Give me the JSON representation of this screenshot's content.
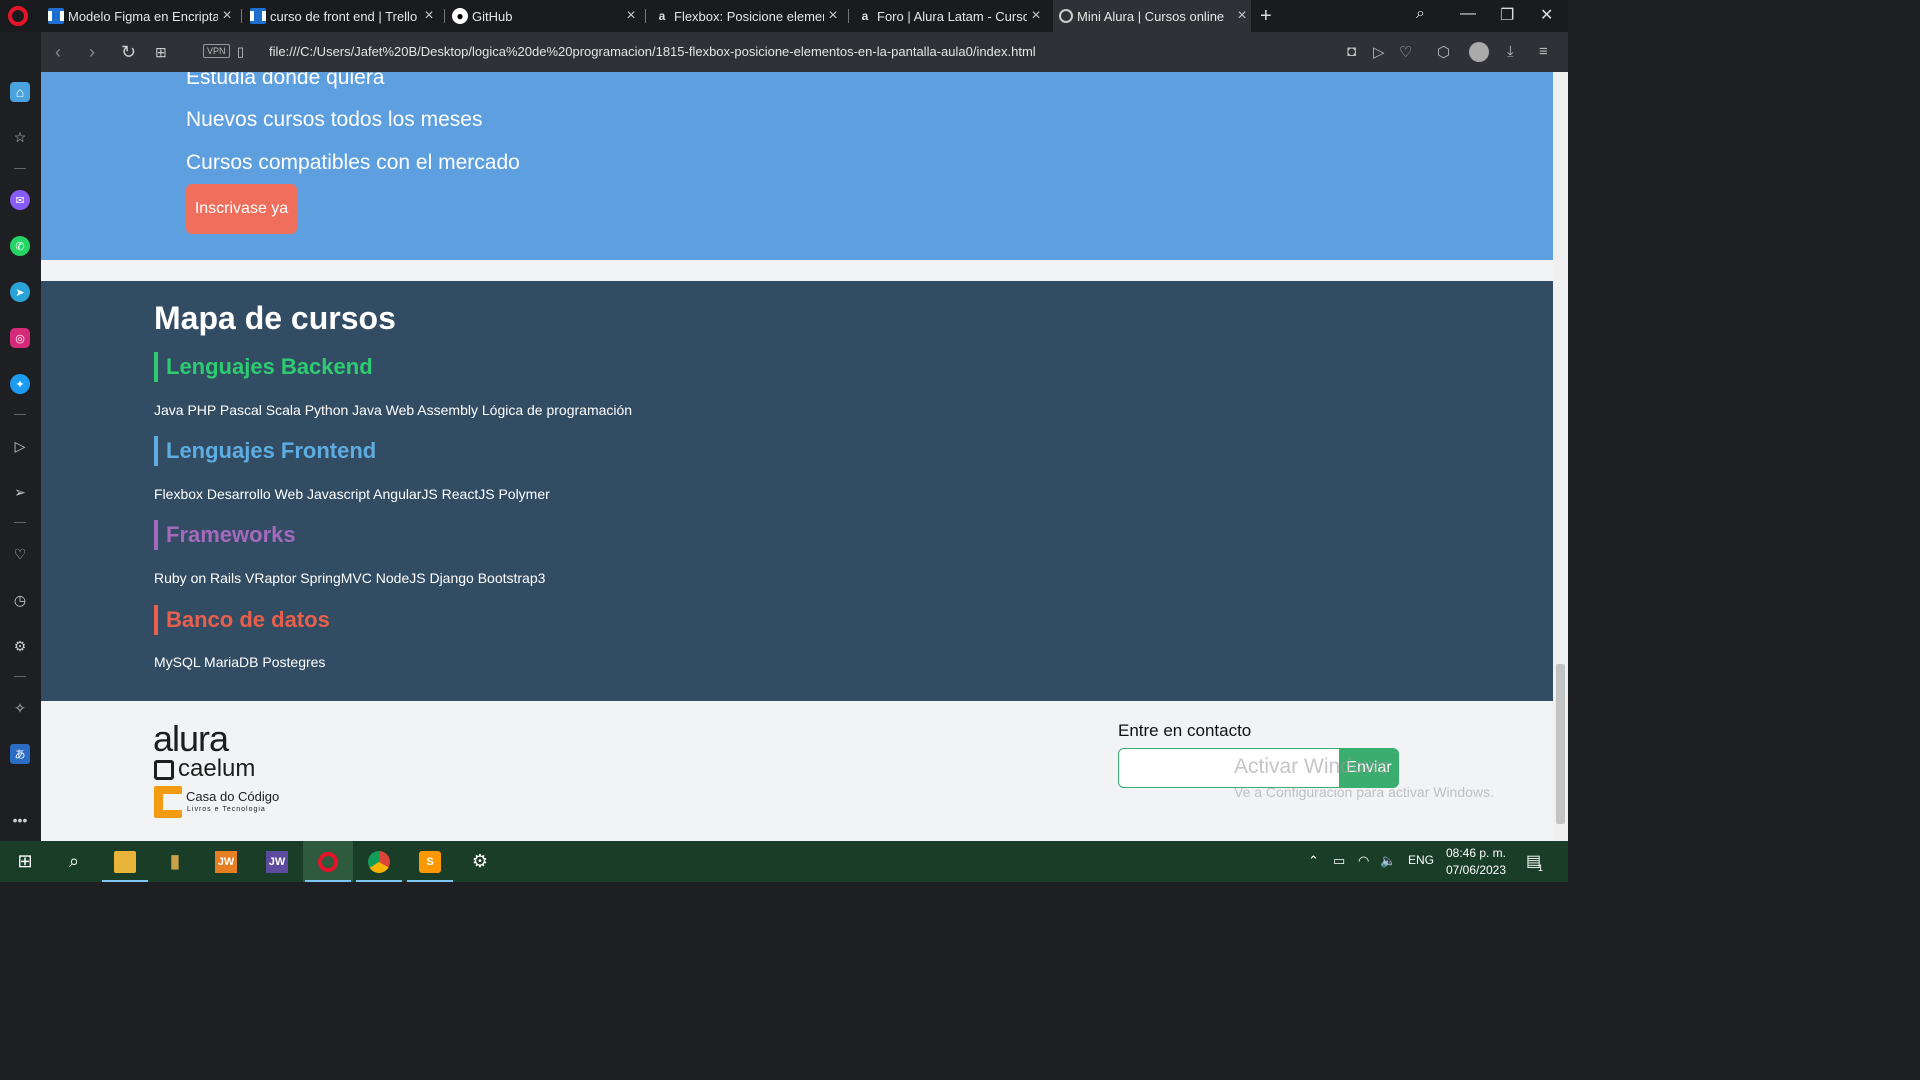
{
  "browser": {
    "tabs": [
      {
        "title": "Modelo Figma en Encriptador",
        "favicon": "trello-icon"
      },
      {
        "title": "curso de front end | Trello",
        "favicon": "trello-icon"
      },
      {
        "title": "GitHub",
        "favicon": "github-icon"
      },
      {
        "title": "Flexbox: Posicione elementos",
        "favicon": "alura-icon"
      },
      {
        "title": "Foro | Alura Latam - Cursos",
        "favicon": "alura-icon"
      },
      {
        "title": "Mini Alura | Cursos online",
        "favicon": "globe-icon"
      }
    ],
    "active_tab": 5,
    "vpn_label": "VPN",
    "url": "file:///C:/Users/Jafet%20B/Desktop/logica%20de%20programacion/1815-flexbox-posicione-elementos-en-la-pantalla-aula0/index.html"
  },
  "page": {
    "hero": {
      "items": [
        "Estudia donde quiera",
        "Nuevos cursos todos los meses",
        "Cursos compatibles con el mercado"
      ],
      "cta_label": "Inscrivase ya"
    },
    "course_map": {
      "title": "Mapa de cursos",
      "categories": [
        {
          "title": "Lenguajes Backend",
          "color": "#2ecc71",
          "courses": "Java PHP Pascal Scala Python Java Web Assembly Lógica de programación"
        },
        {
          "title": "Lenguajes Frontend",
          "color": "#5dade2",
          "courses": "Flexbox Desarrollo Web Javascript AngularJS ReactJS Polymer"
        },
        {
          "title": "Frameworks",
          "color": "#a569bd",
          "courses": "Ruby on Rails VRaptor SpringMVC NodeJS Django Bootstrap3"
        },
        {
          "title": "Banco de datos",
          "color": "#e8604c",
          "courses": "MySQL MariaDB Postegres"
        }
      ]
    },
    "footer": {
      "logo": {
        "alura": "alura",
        "caelum": "caelum",
        "casa": "Casa do Código",
        "casa_sub": "Livros e Tecnologia"
      },
      "contact_label": "Entre en contacto",
      "contact_value": "",
      "send_label": "Enviar"
    }
  },
  "watermark": {
    "line1": "Activar Windows",
    "line2": "Ve a Configuración para activar Windows."
  },
  "taskbar": {
    "language": "ENG",
    "time": "08:46 p. m.",
    "date": "07/06/2023",
    "notifications": "1"
  },
  "colors": {
    "hero_bg": "#5d9fdf",
    "cta_bg": "#ef6f5c",
    "map_bg": "#324c63",
    "send_bg": "#3aad6f"
  }
}
